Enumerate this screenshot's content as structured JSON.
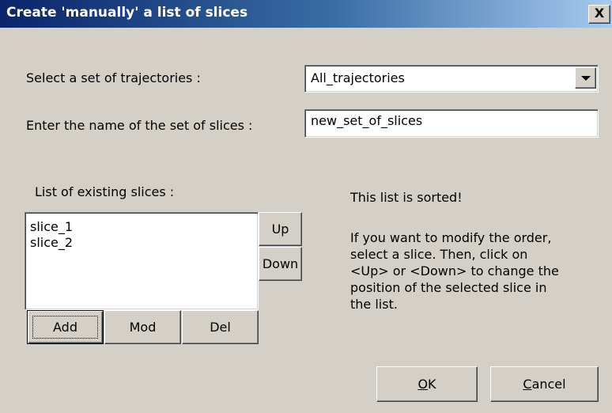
{
  "window": {
    "title": "Create 'manually' a list of slices",
    "close_label": "X"
  },
  "form": {
    "trajectories_label": "Select a set of trajectories :",
    "trajectories_selected": "All_trajectories",
    "slices_name_label": "Enter the name of the set of slices :",
    "slices_name_value": "new_set_of_slices"
  },
  "list": {
    "label": "List of existing slices :",
    "items": [
      "slice_1",
      "slice_2"
    ],
    "up_label": "Up",
    "down_label": "Down",
    "add_label": "Add",
    "mod_label": "Mod",
    "del_label": "Del"
  },
  "info": {
    "sorted": "This list is sorted!",
    "lines": [
      "If you want to modify the order,",
      "select a slice. Then, click on",
      "<Up> or <Down> to change the",
      "position of the selected slice in",
      "the list."
    ]
  },
  "footer": {
    "ok_label": "OK",
    "ok_mnemonic": "O",
    "ok_rest": "K",
    "cancel_label": "Cancel",
    "cancel_mnemonic": "C",
    "cancel_rest": "ancel"
  }
}
